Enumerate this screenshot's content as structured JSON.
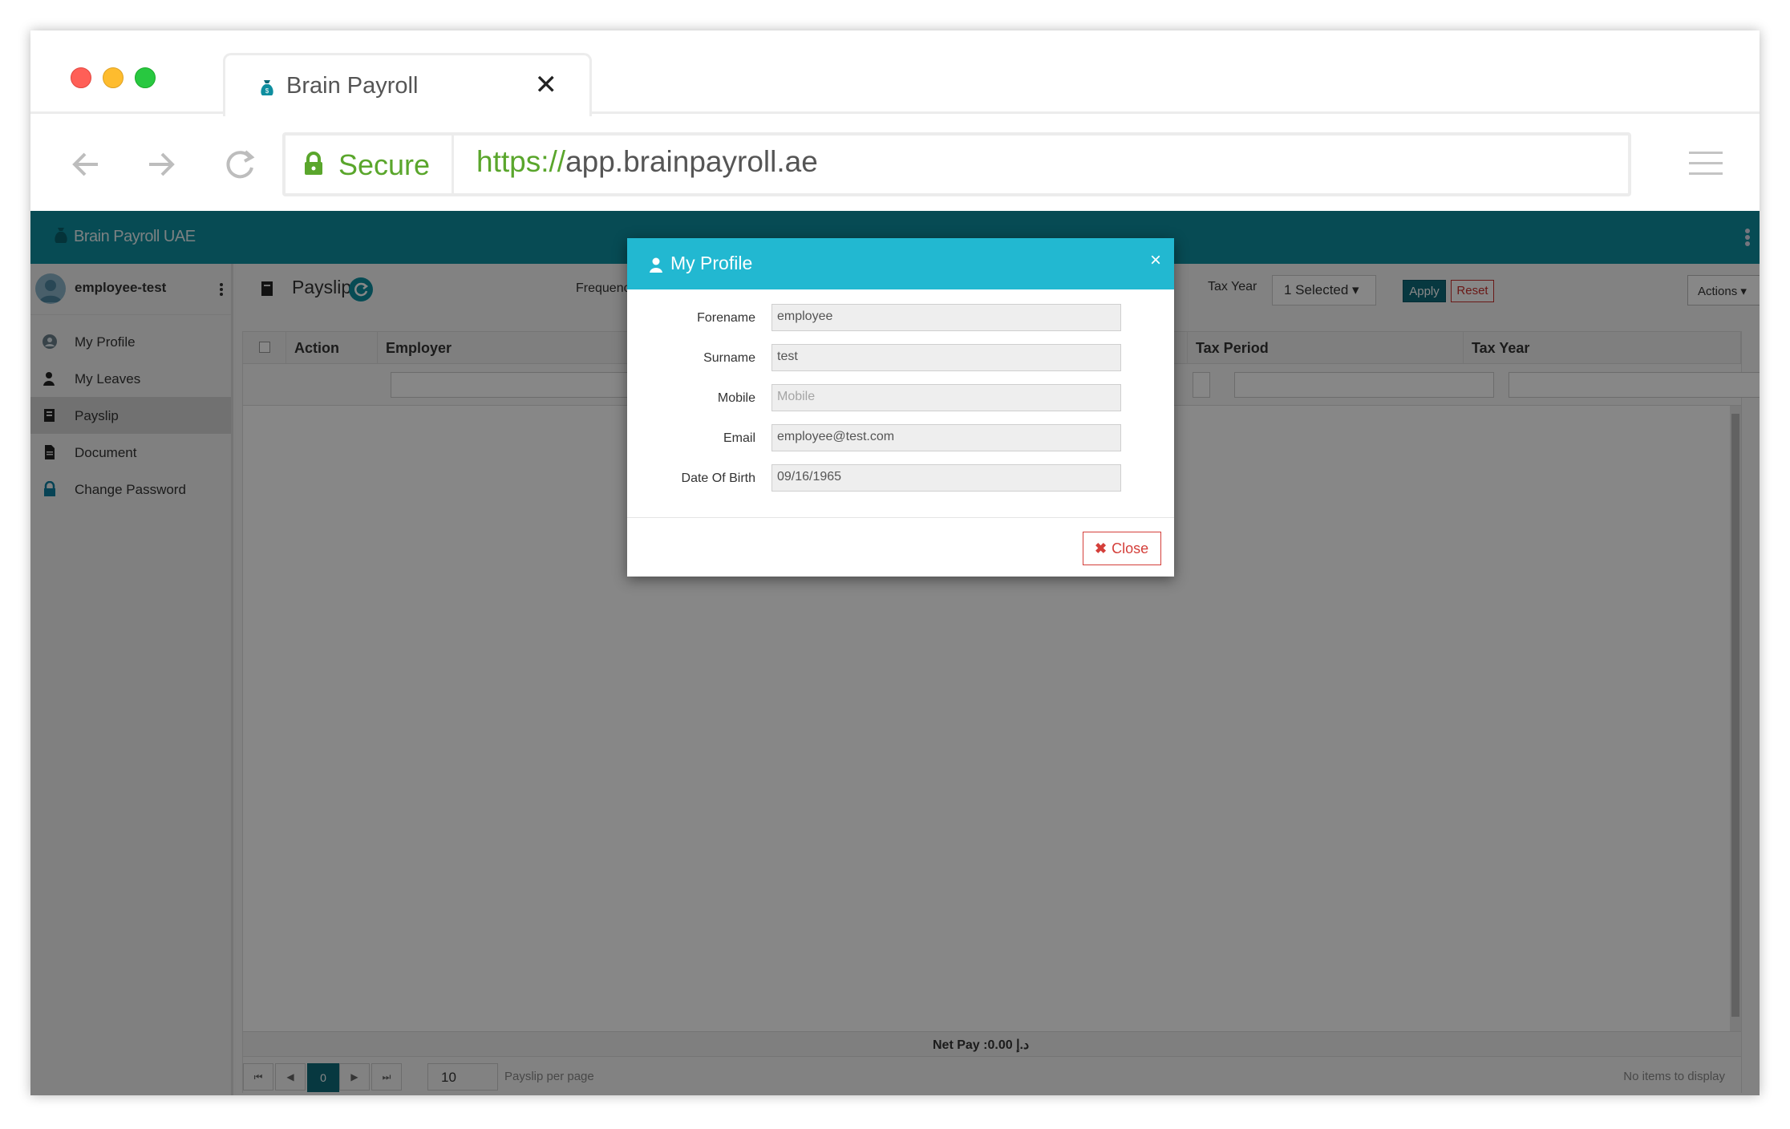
{
  "browser": {
    "tab_title": "Brain Payroll",
    "tab_close": "✕",
    "secure_label": "Secure",
    "url_protocol": "https://",
    "url_host": "app.brainpayroll.ae"
  },
  "app": {
    "brand": "Brain Payroll UAE",
    "user": "employee-test",
    "sidebar": [
      {
        "label": "My Profile",
        "icon": "profile-icon"
      },
      {
        "label": "My Leaves",
        "icon": "user-icon"
      },
      {
        "label": "Payslip",
        "icon": "payslip-icon"
      },
      {
        "label": "Document",
        "icon": "document-icon"
      },
      {
        "label": "Change Password",
        "icon": "lock-icon"
      }
    ],
    "toolbar": {
      "title": "Payslip",
      "frequency_label": "Frequenc",
      "tax_year_label": "Tax Year",
      "selected": "1 Selected ▾",
      "apply": "Apply",
      "reset": "Reset",
      "actions": "Actions ▾"
    },
    "grid": {
      "columns": [
        "Action",
        "Employer",
        "Tax Period",
        "Tax Year"
      ],
      "net_pay": "Net Pay :0.00 د.إ",
      "page": "0",
      "page_size": "10",
      "per_page_label": "Payslip per page",
      "info": "No items to display"
    }
  },
  "modal": {
    "title": "My Profile",
    "close_x": "×",
    "fields": [
      {
        "label": "Forename",
        "value": "employee",
        "placeholder": false
      },
      {
        "label": "Surname",
        "value": "test",
        "placeholder": false
      },
      {
        "label": "Mobile",
        "value": "Mobile",
        "placeholder": true
      },
      {
        "label": "Email",
        "value": "employee@test.com",
        "placeholder": false
      },
      {
        "label": "Date Of Birth",
        "value": "09/16/1965",
        "placeholder": false
      }
    ],
    "close_button": "Close"
  },
  "colors": {
    "header_teal": "#0e8e9f",
    "modal_header": "#22b8d1",
    "secure_green": "#5aa62c",
    "danger_red": "#d43f3a"
  }
}
